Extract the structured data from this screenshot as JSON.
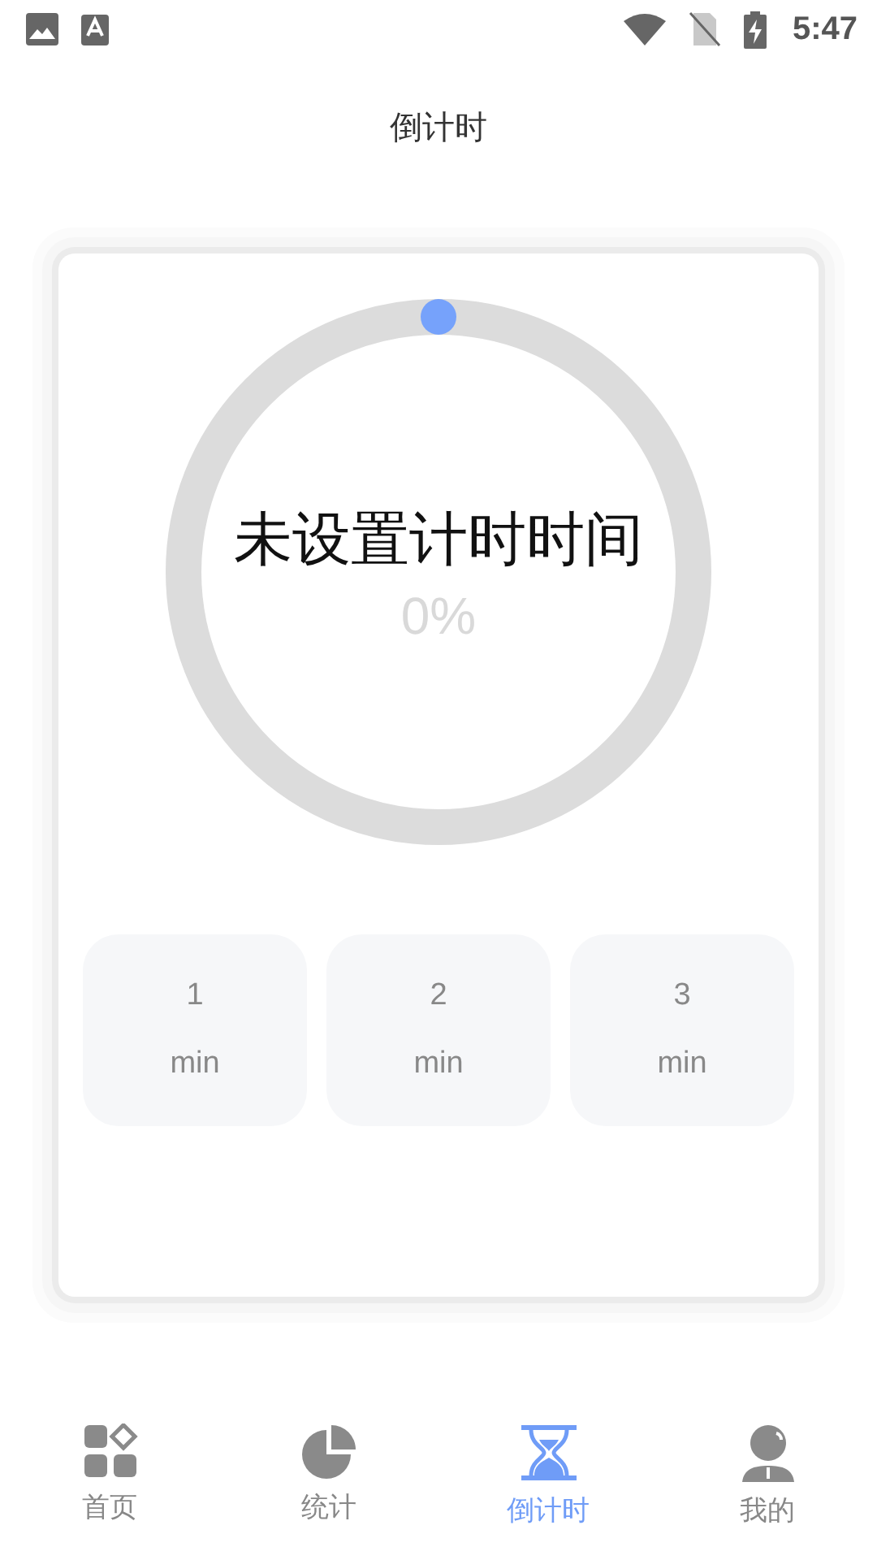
{
  "status_bar": {
    "time": "5:47"
  },
  "title": "倒计时",
  "timer": {
    "label": "未设置计时时间",
    "percent": "0%"
  },
  "presets": [
    {
      "value": "1",
      "unit": "min"
    },
    {
      "value": "2",
      "unit": "min"
    },
    {
      "value": "3",
      "unit": "min"
    }
  ],
  "nav": [
    {
      "label": "首页",
      "selected": false
    },
    {
      "label": "统计",
      "selected": false
    },
    {
      "label": "倒计时",
      "selected": true
    },
    {
      "label": "我的",
      "selected": false
    }
  ]
}
